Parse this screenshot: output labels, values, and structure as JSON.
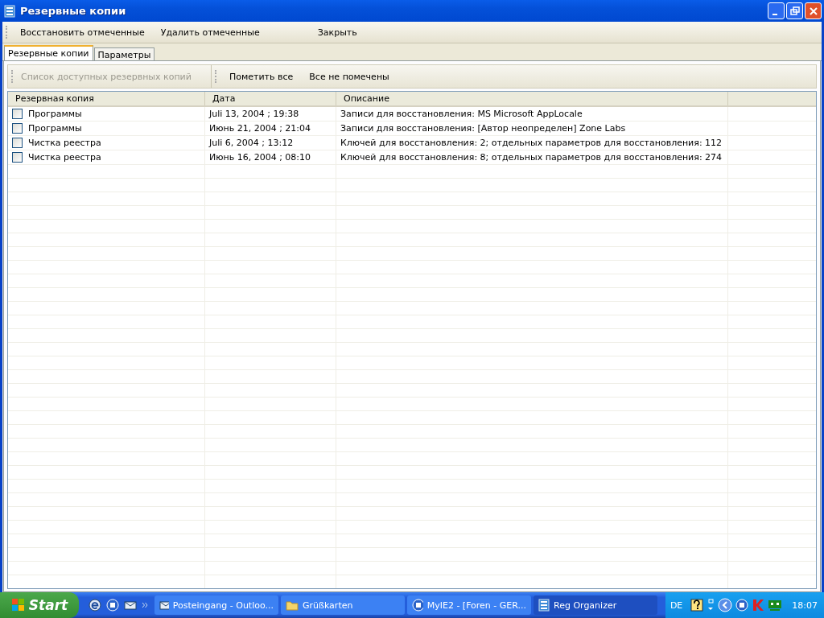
{
  "window": {
    "title": "Резервные копии"
  },
  "toolbar": [
    {
      "label": "Восстановить отмеченные"
    },
    {
      "label": "Удалить отмеченные"
    },
    {
      "label": "Закрыть"
    }
  ],
  "tabs": [
    {
      "label": "Резервные копии",
      "selected": true
    },
    {
      "label": "Параметры",
      "selected": false
    }
  ],
  "subtoolbar": {
    "caption": "Список доступных резервных копий",
    "disabled": true,
    "buttons": [
      "Пометить все",
      "Все не помечены"
    ]
  },
  "table": {
    "columns": [
      "Резервная копия",
      "Дата",
      "Описание"
    ],
    "rows": [
      {
        "name": "Программы",
        "checked": false,
        "date": "Juli 13, 2004 ;  19:38",
        "description": "Записи для восстановления: MS Microsoft AppLocale"
      },
      {
        "name": "Программы",
        "checked": false,
        "date": "Июнь 21, 2004 ;  21:04",
        "description": "Записи для восстановления: [Автор неопределен] Zone Labs"
      },
      {
        "name": "Чистка реестра",
        "checked": false,
        "date": "Juli 6, 2004 ;  13:12",
        "description": "Ключей для восстановления: 2; отдельных параметров для восстановления: 112"
      },
      {
        "name": "Чистка реестра",
        "checked": false,
        "date": "Июнь 16, 2004 ;  08:10",
        "description": "Ключей для восстановления: 8; отдельных параметров для восстановления: 274"
      }
    ]
  },
  "taskbar": {
    "start": "Start",
    "tasks": [
      {
        "label": "Posteingang - Outloo...",
        "selected": false,
        "kind": "mail"
      },
      {
        "label": "Grüßkarten",
        "selected": false,
        "kind": "folder"
      },
      {
        "label": "MyIE2 - [Foren - GER...",
        "selected": false,
        "kind": "browser"
      },
      {
        "label": "Reg Organizer",
        "selected": true,
        "kind": "app"
      }
    ],
    "language": "DE",
    "clock": "18:07"
  }
}
